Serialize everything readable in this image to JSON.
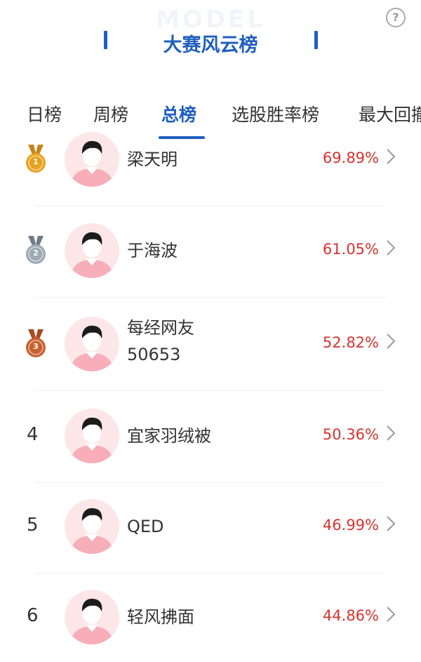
{
  "header": {
    "watermark": "MODEL",
    "title": "大赛风云榜",
    "help_label": "?"
  },
  "tabs": [
    {
      "label": "日榜",
      "active": false
    },
    {
      "label": "周榜",
      "active": false
    },
    {
      "label": "总榜",
      "active": true
    },
    {
      "label": "选股胜率榜",
      "active": false
    },
    {
      "label": "最大回撤",
      "active": false
    }
  ],
  "ranking": [
    {
      "rank": "1",
      "medal": "gold",
      "name": "梁天明",
      "name2": "",
      "rate": "69.89%"
    },
    {
      "rank": "2",
      "medal": "silver",
      "name": "于海波",
      "name2": "",
      "rate": "61.05%"
    },
    {
      "rank": "3",
      "medal": "bronze",
      "name": "每经网友",
      "name2": "50653",
      "rate": "52.82%"
    },
    {
      "rank": "4",
      "medal": "",
      "name": "宜家羽绒被",
      "name2": "",
      "rate": "50.36%"
    },
    {
      "rank": "5",
      "medal": "",
      "name": "QED",
      "name2": "",
      "rate": "46.99%"
    },
    {
      "rank": "6",
      "medal": "",
      "name": "轻风拂面",
      "name2": "",
      "rate": "44.86%"
    }
  ],
  "colors": {
    "accent": "#1f5fbf",
    "rate": "#d8322e",
    "gold": "#e9a21f",
    "silver": "#9ea9b5",
    "bronze": "#c8602f"
  }
}
